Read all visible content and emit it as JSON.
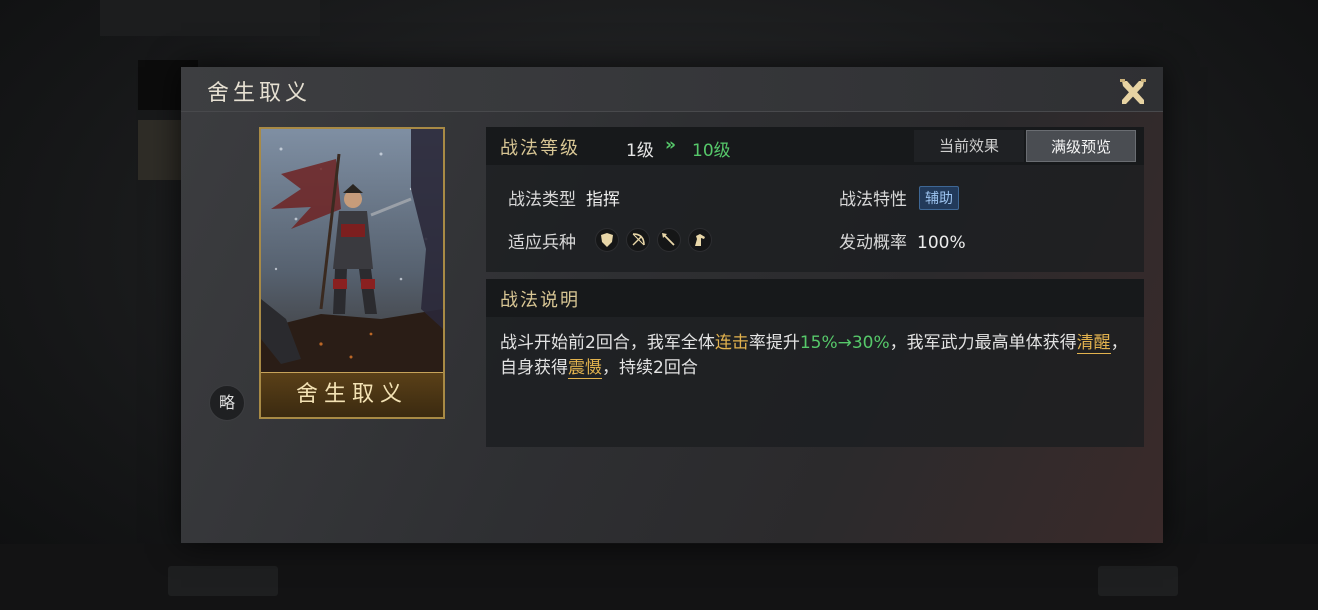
{
  "dialog": {
    "title": "舍生取义"
  },
  "card": {
    "name": "舍生取义",
    "badge": "略"
  },
  "level": {
    "title": "战法等级",
    "from": "1级",
    "arrow": "»",
    "to": "10级",
    "tabs": {
      "current": "当前效果",
      "max": "满级预览"
    }
  },
  "attrs": {
    "type_label": "战法类型",
    "type_value": "指挥",
    "trait_label": "战法特性",
    "trait_value": "辅助",
    "units_label": "适应兵种",
    "units": [
      "shield-icon",
      "bow-icon",
      "spear-icon",
      "horse-icon"
    ],
    "rate_label": "发动概率",
    "rate_value": "100%"
  },
  "description": {
    "title": "战法说明",
    "p1": "战斗开始前2回合，我军全体",
    "k1": "连击",
    "p2": "率提升",
    "k2": "15%→30%",
    "p3": "，我军武力最高单体获得",
    "k3": "清醒",
    "p4": "，自身获得",
    "k4": "震慑",
    "p5": "，持续2回合"
  },
  "colors": {
    "gold": "#e2b24e",
    "green": "#56c86a",
    "title_gold": "#d8c694"
  }
}
